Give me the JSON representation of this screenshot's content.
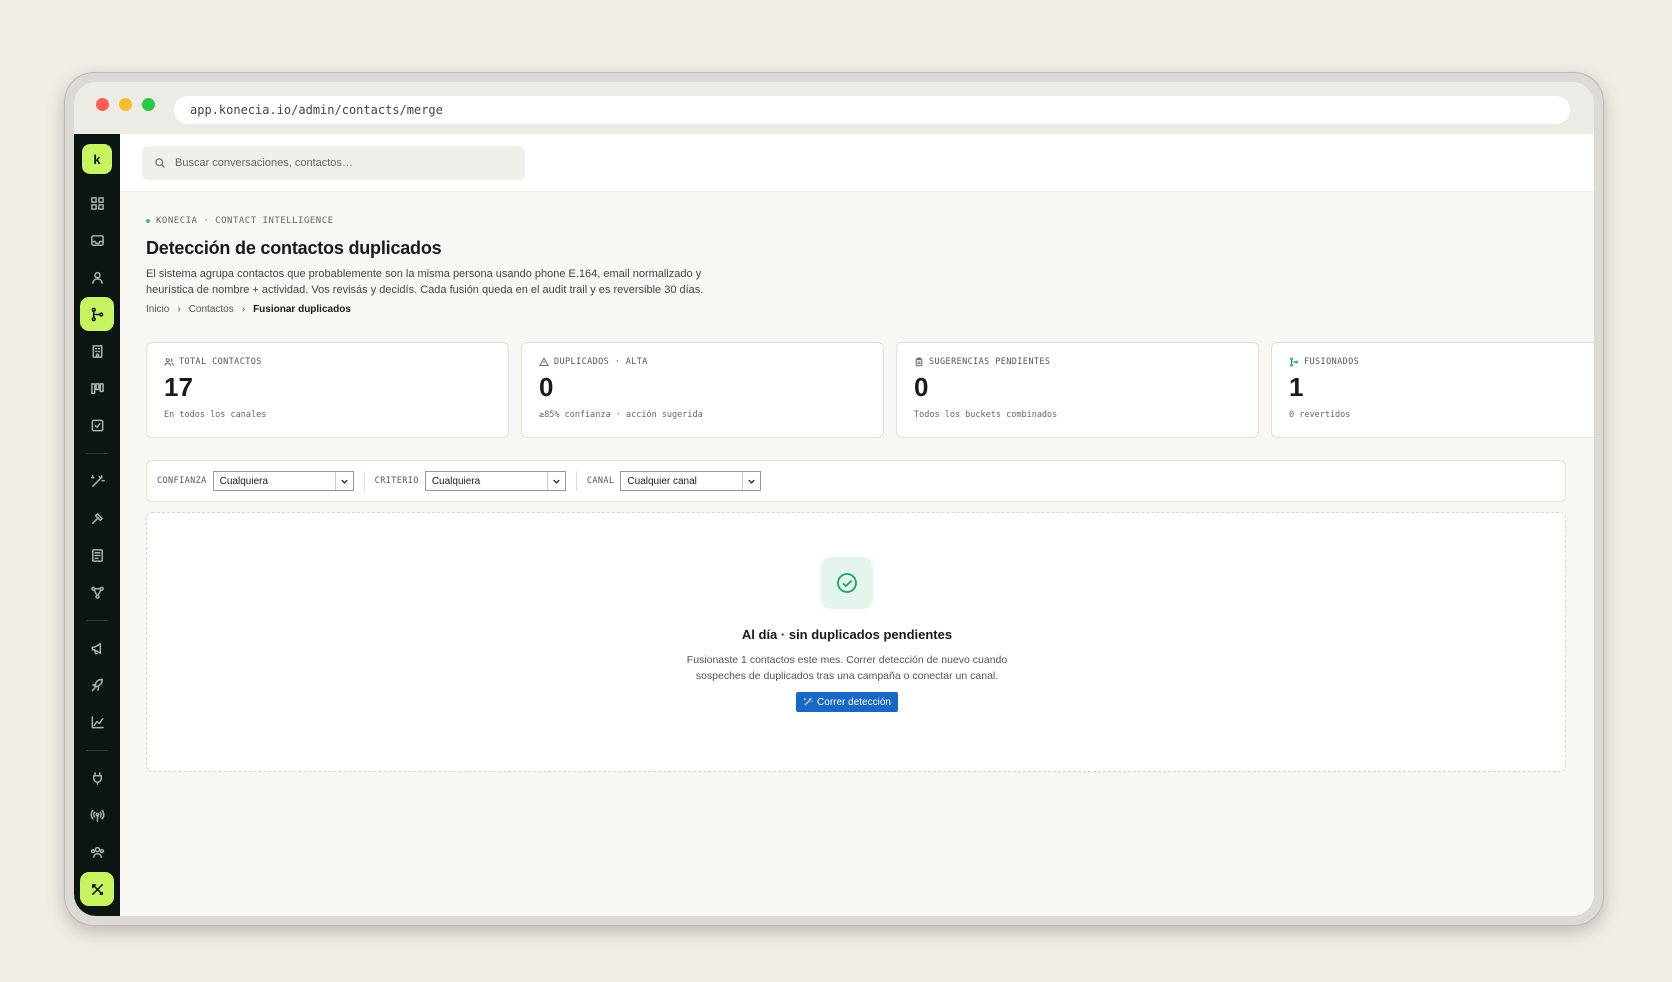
{
  "browser": {
    "url": "app.konecia.io/admin/contacts/merge",
    "dot_colors": [
      "#ff5f57",
      "#febc2e",
      "#28c840"
    ]
  },
  "rail": {
    "logo": "k",
    "icons": [
      "grid-icon",
      "inbox-icon",
      "user-icon",
      "merge-icon",
      "building-icon",
      "kanban-icon",
      "task-icon",
      "wand-icon",
      "hammer-icon",
      "notebook-icon",
      "flow-icon",
      "megaphone-icon",
      "rocket-icon",
      "chart-icon",
      "plug-icon",
      "broadcast-icon",
      "team-icon",
      "tools-icon"
    ],
    "active": "merge-icon",
    "accent": "#c7f560"
  },
  "search": {
    "placeholder": "Buscar conversaciones, contactos…"
  },
  "header": {
    "eyebrow": "KONECIA · CONTACT INTELLIGENCE",
    "title": "Detección de contactos duplicados",
    "description_line1": "El sistema agrupa contactos que probablemente son la misma persona usando phone E.164, email normalizado y",
    "description_line2": "heurística de nombre + actividad. Vos revisás y decidís. Cada fusión queda en el audit trail y es reversible 30 días.",
    "breadcrumb": {
      "home": "Inicio",
      "contacts": "Contactos",
      "current": "Fusionar duplicados"
    }
  },
  "stats": [
    {
      "icon": "users-icon",
      "label": "TOTAL CONTACTOS",
      "value": "17",
      "sub": "En todos los canales"
    },
    {
      "icon": "warning-icon",
      "label": "DUPLICADOS · ALTA",
      "value": "0",
      "sub": "≥85% confianza · acción sugerida"
    },
    {
      "icon": "clipboard-icon",
      "label": "SUGERENCIAS PENDIENTES",
      "value": "0",
      "sub": "Todos los buckets combinados"
    },
    {
      "icon": "merge-icon",
      "label": "FUSIONADOS",
      "value": "1",
      "sub": "0 revertidos"
    }
  ],
  "filters": {
    "confianza_label": "CONFIANZA",
    "confianza_value": "Cualquiera",
    "criterio_label": "CRITERIO",
    "criterio_value": "Cualquiera",
    "canal_label": "CANAL",
    "canal_value": "Cualquier canal"
  },
  "empty_state": {
    "title": "Al día · sin duplicados pendientes",
    "text_line1": "Fusionaste 1 contactos este mes. Correr detección de nuevo cuando",
    "text_line2": "sospeches de duplicados tras una campaña o conectar un canal.",
    "button": "Correr detección",
    "icon": "check-circle-icon",
    "button_color": "#1769c4"
  }
}
